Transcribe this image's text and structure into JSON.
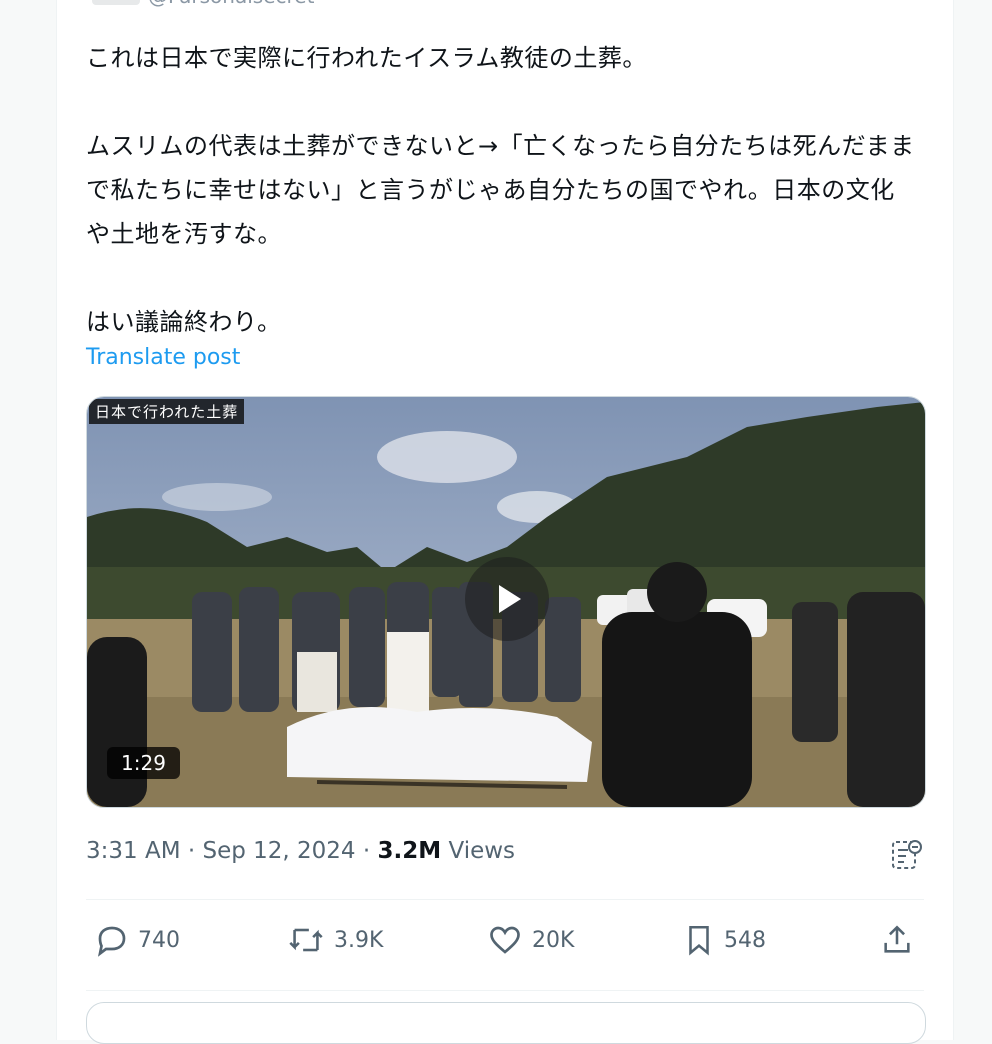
{
  "tweet": {
    "handle": "@Parsonalsecret",
    "text": "これは日本で実際に行われたイスラム教徒の土葬。\n\nムスリムの代表は土葬ができないと→「亡くなったら自分たちは死んだままで私たちに幸せはない」と言うがじゃあ自分たちの国でやれ。日本の文化や土地を汚すな。\n\nはい議論終わり。",
    "translate_label": "Translate post"
  },
  "media": {
    "caption": "日本で行われた土葬",
    "duration": "1:29",
    "play_icon": "play-icon"
  },
  "meta": {
    "time": "3:31 AM",
    "separator": "·",
    "date": "Sep 12, 2024",
    "views_count": "3.2M",
    "views_label": "Views",
    "stats_icon": "analytics-icon"
  },
  "actions": {
    "replies": "740",
    "reposts": "3.9K",
    "likes": "20K",
    "bookmarks": "548"
  },
  "colors": {
    "accent": "#1d9bf0",
    "text": "#0f1419",
    "muted": "#536471"
  }
}
